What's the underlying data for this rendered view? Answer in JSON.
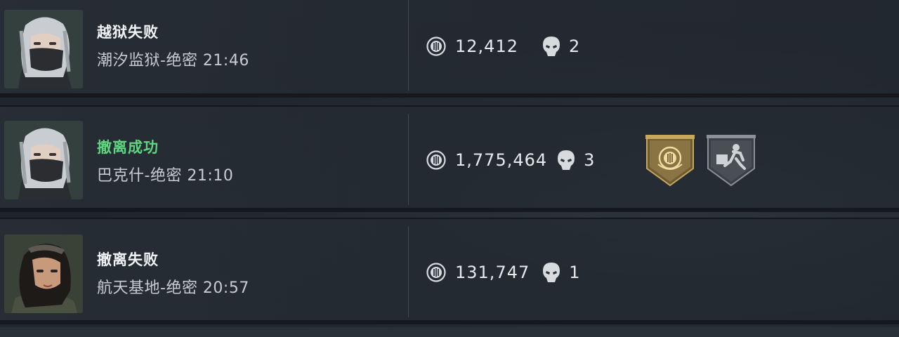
{
  "matches": [
    {
      "result": "越狱失败",
      "map_line": "潮汐监狱-绝密 21:46",
      "value": "12,412",
      "kills": "2",
      "result_color": "#f2f3f4"
    },
    {
      "result": "撤离成功",
      "map_line": "巴克什-绝密 21:10",
      "value": "1,775,464",
      "kills": "3",
      "result_color": "#5fd77f",
      "badges": [
        "gold-emblem",
        "escape-runner"
      ]
    },
    {
      "result": "撤离失败",
      "map_line": "航天基地-绝密 20:57",
      "value": "131,747",
      "kills": "1",
      "result_color": "#f2f3f4"
    }
  ],
  "icons": {
    "currency": "coin-icon",
    "kills": "skull-icon"
  },
  "colors": {
    "success": "#5fd77f",
    "text": "#e7e9ec",
    "background": "#1e242b",
    "gold": "#c9a75a"
  }
}
